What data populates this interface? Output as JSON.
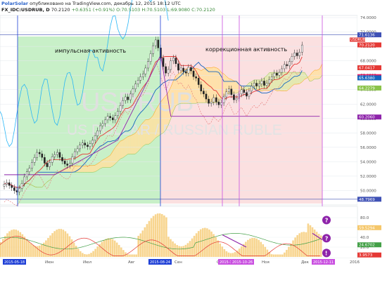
{
  "header": {
    "author": "PolarSolar",
    "published": "опубликовано на TradingView.com, декабрь 12, 2015 18:12 UTC",
    "symbol": "FX_IDC:USDRUB, D",
    "price": "70.2120",
    "change": "+0.6351 (+0.91%)",
    "open": "O:70.5103",
    "high": "H:70.5103",
    "low": "L:69.9080",
    "close": "C:70.2120"
  },
  "watermark": {
    "symbol": "USDRUB",
    "name": "US DOLLAR / RUSSIAN RUBLE"
  },
  "chart_data": [
    {
      "type": "candlestick",
      "panel": "price",
      "y_ticks": [
        50.0,
        52.0,
        54.0,
        56.0,
        58.0,
        60.0,
        62.0,
        64.0,
        66.0,
        68.0,
        70.0,
        72.0,
        74.0
      ],
      "ylim": [
        48.0,
        74.3
      ],
      "x_ticks": [
        "Июн",
        "Июл",
        "Авг",
        "Сен",
        "Окт",
        "Ноя",
        "Дек",
        "2016"
      ],
      "date_markers": [
        "2015-05-18",
        "2015-08-24",
        "2015-10-20",
        "2015-10-26",
        "2015-12-11"
      ],
      "annotations": [
        "импульсная активность",
        "коррекционная активность"
      ],
      "price_labels": [
        {
          "value": 71.6136,
          "color": "#3f51b5"
        },
        {
          "value": 70.212,
          "color": "#e53935",
          "tag": "USDRUB"
        },
        {
          "value": 67.0417,
          "color": "#e53935"
        },
        {
          "value": 65.81,
          "color": "#e91e63"
        },
        {
          "value": 65.638,
          "color": "#1565c0"
        },
        {
          "value": 64.2279,
          "color": "#8bc34a"
        },
        {
          "value": 60.206,
          "color": "#8e24aa"
        },
        {
          "value": 48.7969,
          "color": "#3f51b5"
        }
      ],
      "close": [
        50.9,
        51.1,
        50.7,
        50.4,
        50.0,
        49.8,
        50.3,
        51.0,
        51.9,
        52.6,
        53.1,
        53.9,
        54.6,
        55.3,
        55.1,
        54.6,
        53.8,
        53.3,
        53.9,
        54.7,
        55.0,
        55.3,
        54.6,
        54.1,
        53.7,
        53.5,
        53.8,
        54.7,
        55.4,
        55.8,
        56.3,
        56.6,
        56.3,
        56.1,
        56.5,
        57.0,
        57.6,
        58.3,
        59.0,
        59.3,
        59.8,
        60.3,
        60.1,
        59.8,
        60.4,
        61.0,
        61.8,
        62.5,
        63.0,
        62.6,
        63.4,
        64.1,
        64.8,
        65.3,
        65.8,
        66.2,
        67.0,
        67.9,
        69.0,
        70.1,
        70.9,
        69.8,
        68.4,
        67.2,
        66.3,
        66.8,
        68.0,
        68.4,
        67.6,
        66.7,
        67.0,
        66.5,
        66.3,
        67.1,
        66.6,
        65.8,
        65.6,
        64.7,
        63.8,
        63.4,
        62.7,
        62.1,
        62.3,
        62.9,
        62.3,
        61.9,
        62.2,
        63.0,
        63.7,
        64.1,
        63.3,
        62.6,
        62.8,
        63.4,
        64.0,
        63.6,
        63.1,
        63.8,
        64.5,
        64.9,
        64.5,
        64.8,
        65.2,
        64.6,
        64.9,
        65.4,
        65.8,
        66.3,
        66.0,
        66.4,
        66.9,
        67.5,
        67.3,
        67.9,
        68.6,
        69.1,
        68.7,
        69.2,
        70.2
      ]
    },
    {
      "type": "line",
      "panel": "oscillator",
      "y_ticks": [
        20.0,
        40.0,
        60.0,
        80.0
      ],
      "ylim": [
        0,
        100
      ],
      "last_values": [
        {
          "value": 59.5294,
          "color": "#f5c76a"
        },
        {
          "value": 24.6702,
          "color": "#43a047"
        },
        {
          "value": 3.9573,
          "color": "#e53935"
        }
      ],
      "markers": [
        "?",
        "?",
        "!"
      ]
    }
  ]
}
